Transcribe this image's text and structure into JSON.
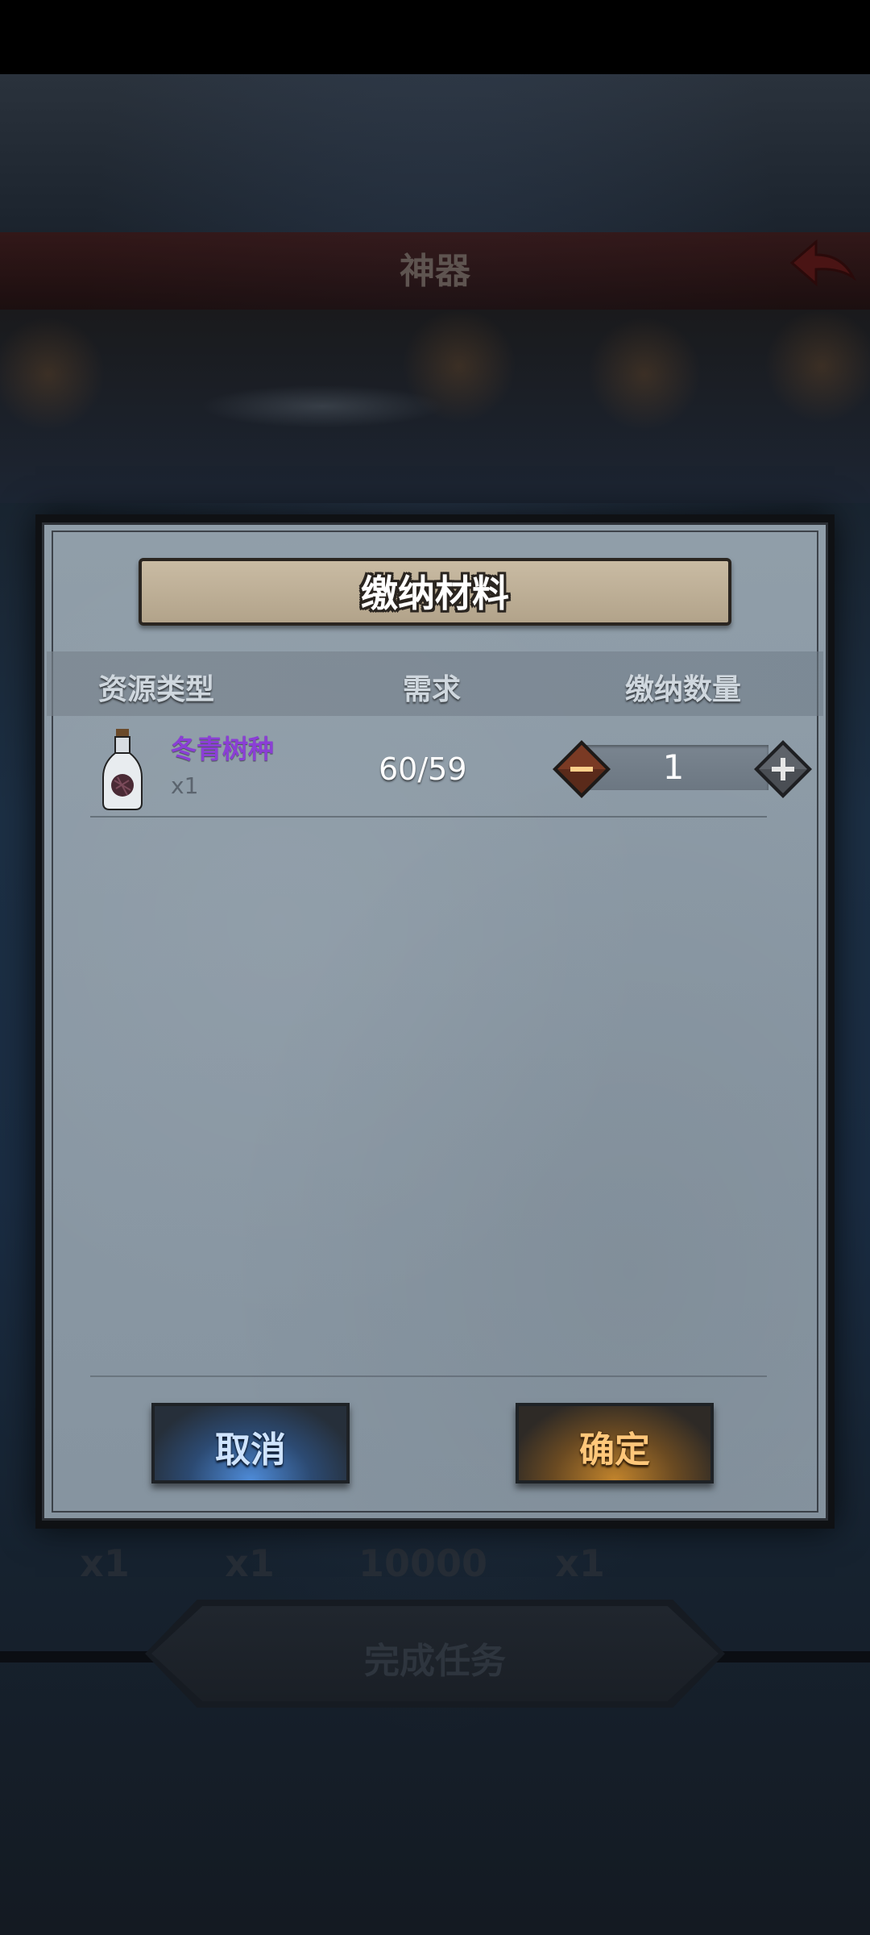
{
  "scene": {
    "title": "神器",
    "bottom_counts": [
      "x1",
      "x1",
      "10000",
      "x1"
    ],
    "complete_button": "完成任务"
  },
  "dialog": {
    "title": "缴纳材料",
    "headers": {
      "resource_type": "资源类型",
      "requirement": "需求",
      "submit_quantity": "缴纳数量"
    },
    "item": {
      "name": "冬青树种",
      "owned": "x1",
      "requirement": "60/59",
      "submit_value": "1",
      "name_color": "#8b3fd6",
      "icon": "bottle-icon"
    },
    "stepper": {
      "minus_icon": "minus-icon",
      "plus_icon": "plus-icon"
    },
    "buttons": {
      "cancel": "取消",
      "confirm": "确定"
    }
  },
  "colors": {
    "cancel_glow": "#4e8bd8",
    "confirm_glow": "#c2842c",
    "confirm_text": "#ffc77a",
    "cancel_text": "#cfe4ff"
  }
}
